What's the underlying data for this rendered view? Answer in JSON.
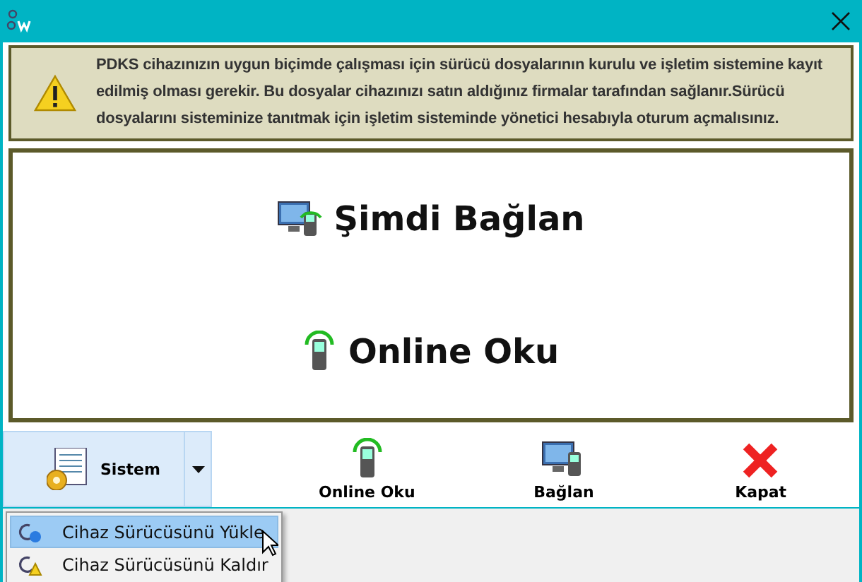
{
  "notice": {
    "text": "PDKS cihazınızın uygun biçimde çalışması için sürücü dosyalarının kurulu ve işletim sistemine kayıt edilmiş olması gerekir. Bu dosyalar cihazınızı satın aldığınız firmalar tarafından sağlanır.Sürücü dosyalarını sisteminize tanıtmak için işletim sisteminde yönetici hesabıyla oturum açmalısınız."
  },
  "actions": [
    {
      "label": "Şimdi Bağlan",
      "kind": "connect"
    },
    {
      "label": "Online Oku",
      "kind": "phone"
    }
  ],
  "toolbar": {
    "split_button": {
      "label": "Sistem",
      "expanded": true
    },
    "buttons": [
      {
        "label": "Online Oku",
        "kind": "phone"
      },
      {
        "label": "Bağlan",
        "kind": "connect"
      },
      {
        "label": "Kapat",
        "kind": "close"
      }
    ]
  },
  "menu": [
    {
      "label": "Cihaz Sürücüsünü Yükle",
      "kind": "install",
      "selected": true
    },
    {
      "label": "Cihaz Sürücüsünü Kaldır",
      "kind": "warn",
      "selected": false
    }
  ]
}
